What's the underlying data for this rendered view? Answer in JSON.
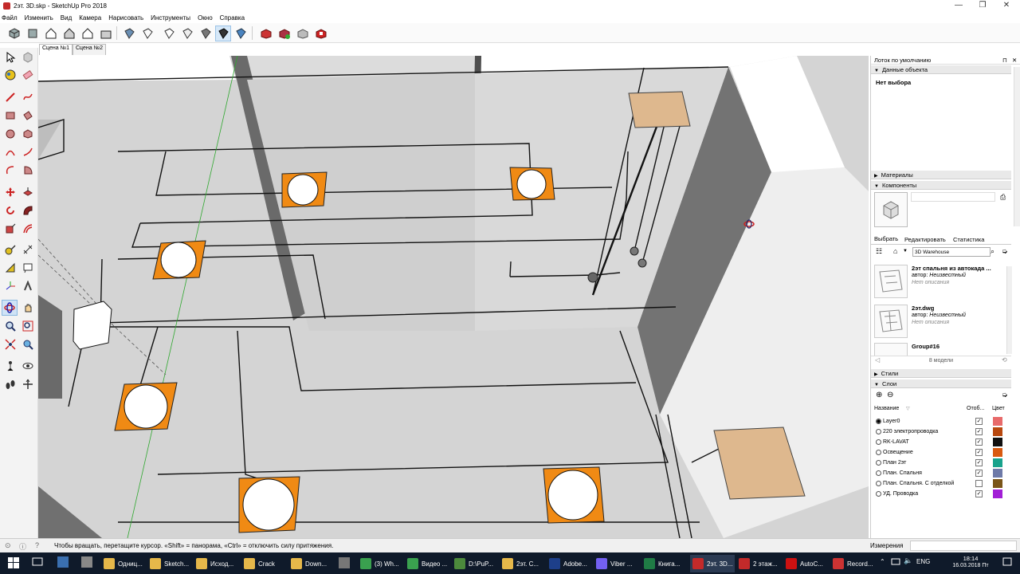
{
  "window": {
    "title": "2эт. 3D.skp - SketchUp Pro 2018",
    "controls": [
      "—",
      "❐",
      "✕"
    ]
  },
  "menu": [
    "Файл",
    "Изменить",
    "Вид",
    "Камера",
    "Нарисовать",
    "Инструменты",
    "Окно",
    "Справка"
  ],
  "scenes": [
    "Сцена №1",
    "Сцена №2"
  ],
  "tray": {
    "title": "Лоток по умолчанию",
    "entity_info": {
      "header": "Данные объекта",
      "value": "Нет выбора"
    },
    "materials": {
      "header": "Материалы"
    },
    "components": {
      "header": "Компоненты",
      "tabs": [
        "Выбрать",
        "Редактировать",
        "Статистика"
      ],
      "search_value": "3D Warehouse",
      "items": [
        {
          "name": "2эт спальня из автокада ...",
          "author_label": "автор:",
          "author": "Неизвестный",
          "description": "Нет описания"
        },
        {
          "name": "2эт.dwg",
          "author_label": "автор:",
          "author": "Неизвестный",
          "description": "Нет описания"
        },
        {
          "name": "Group#16",
          "author_label": "",
          "author": "",
          "description": ""
        }
      ],
      "count_label": "8 модели"
    },
    "styles": {
      "header": "Стили"
    },
    "layers": {
      "header": "Слои",
      "col_name": "Название",
      "col_visible": "Отоб...",
      "col_color": "Цвет",
      "rows": [
        {
          "name": "Layer0",
          "active": true,
          "visible": true,
          "color": "#e86a6a"
        },
        {
          "name": "220 электропроводка",
          "active": false,
          "visible": true,
          "color": "#b8480e"
        },
        {
          "name": "RK-LAVAT",
          "active": false,
          "visible": true,
          "color": "#111111"
        },
        {
          "name": "Освещение",
          "active": false,
          "visible": true,
          "color": "#d95a10"
        },
        {
          "name": "План 2эт",
          "active": false,
          "visible": true,
          "color": "#18a28c"
        },
        {
          "name": "План. Спальня",
          "active": false,
          "visible": true,
          "color": "#6e7aa8"
        },
        {
          "name": "План. Спальня. С отделкой",
          "active": false,
          "visible": false,
          "color": "#7a5518"
        },
        {
          "name": "УД. Проводка",
          "active": false,
          "visible": true,
          "color": "#a21fd6"
        }
      ]
    }
  },
  "status": {
    "hint": "Чтобы вращать, перетащите курсор. «Shift» = панорама, «Ctrl» = отключить силу притяжения.",
    "measure_label": "Измерения"
  },
  "taskbar": {
    "apps": [
      {
        "label": "Одниц...",
        "color": "#e6b84a"
      },
      {
        "label": "Sketch...",
        "color": "#e6b84a"
      },
      {
        "label": "Исход...",
        "color": "#e6b84a"
      },
      {
        "label": "Crack",
        "color": "#e6b84a"
      },
      {
        "label": "Down...",
        "color": "#e6b84a"
      },
      {
        "label": "(3) Wh...",
        "color": "#3aa14f"
      },
      {
        "label": "Видео ...",
        "color": "#3aa14f"
      },
      {
        "label": "D:\\PuP...",
        "color": "#4c8a3c"
      },
      {
        "label": "2эт. С...",
        "color": "#e6b84a"
      },
      {
        "label": "Adobe...",
        "color": "#1d3f8a"
      },
      {
        "label": "Viber ...",
        "color": "#7360f2"
      },
      {
        "label": "Книга...",
        "color": "#1f7b45"
      },
      {
        "label": "2эт. 3D...",
        "color": "#c32a2a"
      },
      {
        "label": "2 этаж...",
        "color": "#c32a2a"
      },
      {
        "label": "AutoC...",
        "color": "#c11"
      },
      {
        "label": "Record...",
        "color": "#c33"
      }
    ],
    "lang": "ENG",
    "time": "18:14",
    "date": "16.03.2018 Пт"
  }
}
